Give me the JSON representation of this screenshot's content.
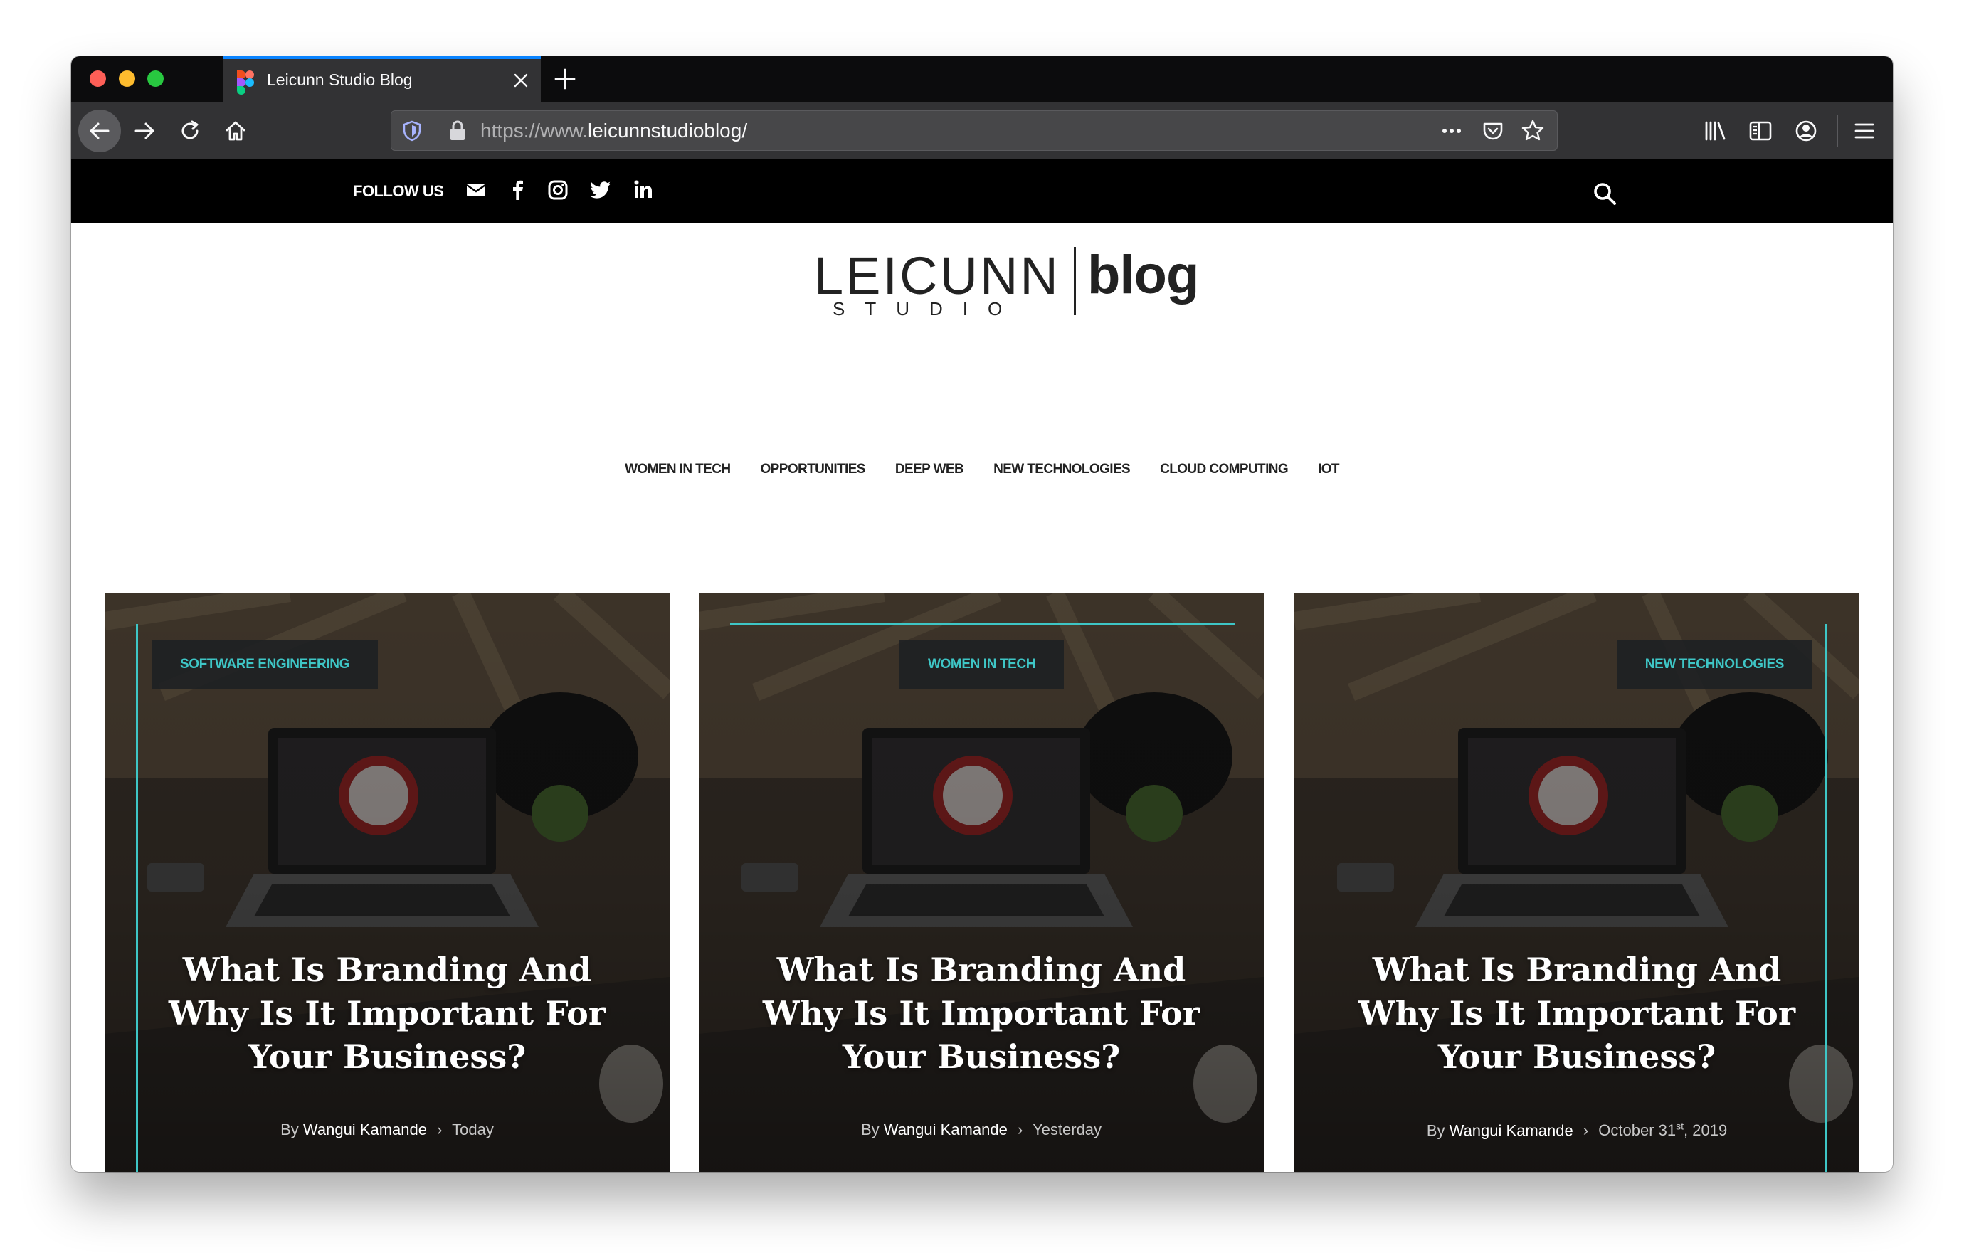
{
  "browser": {
    "tab_title": "Leicunn Studio Blog",
    "url_prefix": "https://www.",
    "url_host": "leicunnstudioblog/"
  },
  "topbar": {
    "follow_label": "FOLLOW US",
    "social_icons": [
      "mail-icon",
      "facebook-icon",
      "instagram-icon",
      "twitter-icon",
      "linkedin-icon"
    ]
  },
  "logo": {
    "wordmark": "LEICUNN",
    "sub": "STUDIO",
    "suffix": "blog"
  },
  "nav": {
    "items": [
      "WOMEN IN TECH",
      "OPPORTUNITIES",
      "DEEP WEB",
      "NEW TECHNOLOGIES",
      "CLOUD COMPUTING",
      "IOT"
    ]
  },
  "cards": [
    {
      "category": "SOFTWARE ENGINEERING",
      "title": "What Is Branding And Why Is It Important For Your Business?",
      "by": "By",
      "author": "Wangui Kamande",
      "date": "Today",
      "date_sup": ""
    },
    {
      "category": "WOMEN IN TECH",
      "title": "What Is Branding And Why Is It Important For Your Business?",
      "by": "By",
      "author": "Wangui Kamande",
      "date": "Yesterday",
      "date_sup": ""
    },
    {
      "category": "NEW TECHNOLOGIES",
      "title": "What Is Branding And Why Is It Important For Your Business?",
      "by": "By",
      "author": "Wangui Kamande",
      "date_prefix": "October 31",
      "date_sup": "st",
      "date_suffix": ", 2019"
    }
  ],
  "colors": {
    "accent": "#3ec6c6",
    "topbar_bg": "#000000",
    "browser_chrome": "#323234",
    "tab_indicator": "#0a84ff"
  }
}
